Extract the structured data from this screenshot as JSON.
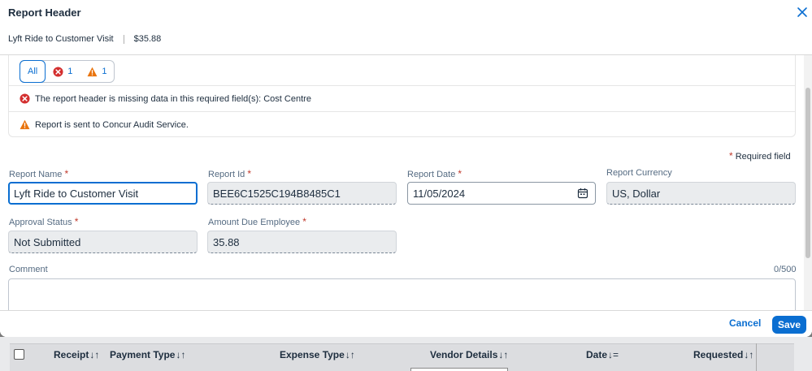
{
  "dialog": {
    "title": "Report Header",
    "subtitle_name": "Lyft Ride to Customer Visit",
    "subtitle_amount": "$35.88"
  },
  "messages": {
    "filter_all": "All",
    "error_count": "1",
    "warning_count": "1",
    "items": [
      {
        "type": "error",
        "text": "The report header is missing data in this required field(s): Cost Centre"
      },
      {
        "type": "warning",
        "text": "Report is sent to Concur Audit Service."
      }
    ]
  },
  "form": {
    "required_star": "*",
    "required_note": "Required field",
    "report_name": {
      "label": "Report Name",
      "value": "Lyft Ride to Customer Visit"
    },
    "report_id": {
      "label": "Report Id",
      "value": "BEE6C1525C194B8485C1"
    },
    "report_date": {
      "label": "Report Date",
      "value": "11/05/2024"
    },
    "report_currency": {
      "label": "Report Currency",
      "value": "US, Dollar"
    },
    "approval_status": {
      "label": "Approval Status",
      "value": "Not Submitted"
    },
    "amount_due": {
      "label": "Amount Due Employee",
      "value": "35.88"
    },
    "comment": {
      "label": "Comment",
      "counter": "0/500"
    }
  },
  "footer": {
    "cancel_label": "Cancel",
    "save_label": "Save"
  },
  "background_table": {
    "columns": [
      {
        "label": "Receipt",
        "sort": "↓↑"
      },
      {
        "label": "Payment Type",
        "sort": "↓↑"
      },
      {
        "label": "Expense Type",
        "sort": "↓↑"
      },
      {
        "label": "Vendor Details",
        "sort": "↓↑"
      },
      {
        "label": "Date",
        "sort": "↓="
      },
      {
        "label": "Requested",
        "sort": "↓↑"
      }
    ]
  },
  "colors": {
    "accent": "#0a6ed1",
    "error": "#d32f2f",
    "warning": "#e9730c"
  },
  "icons": {
    "close": "close-icon",
    "error": "error-circle-icon",
    "warning": "warning-triangle-icon",
    "calendar": "calendar-icon"
  }
}
